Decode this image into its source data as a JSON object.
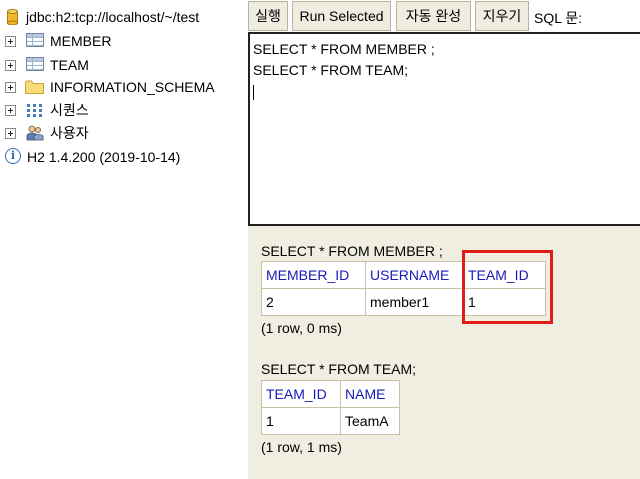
{
  "tree": {
    "connection": "jdbc:h2:tcp://localhost/~/test",
    "items": [
      {
        "label": "MEMBER",
        "icon": "table-icon"
      },
      {
        "label": "TEAM",
        "icon": "table-icon"
      },
      {
        "label": "INFORMATION_SCHEMA",
        "icon": "folder-icon"
      },
      {
        "label": "시퀀스",
        "icon": "sequence-icon"
      },
      {
        "label": "사용자",
        "icon": "users-icon"
      }
    ],
    "version": "H2 1.4.200 (2019-10-14)"
  },
  "toolbar": {
    "run_label": "실행",
    "run_selected_label": "Run Selected",
    "autocomplete_label": "자동 완성",
    "clear_label": "지우기",
    "sql_label": "SQL 문:"
  },
  "editor": {
    "line1": "SELECT * FROM MEMBER ;",
    "line2": "SELECT * FROM TEAM;"
  },
  "results": [
    {
      "query": "SELECT * FROM MEMBER ;",
      "columns": [
        "MEMBER_ID",
        "USERNAME",
        "TEAM_ID"
      ],
      "rows": [
        [
          "2",
          "member1",
          "1"
        ]
      ],
      "meta": "(1 row, 0 ms)"
    },
    {
      "query": "SELECT * FROM TEAM;",
      "columns": [
        "TEAM_ID",
        "NAME"
      ],
      "rows": [
        [
          "1",
          "TeamA"
        ]
      ],
      "meta": "(1 row, 1 ms)"
    }
  ],
  "colors": {
    "panel_bg": "#f0eee0",
    "header_text": "#1a1ab8",
    "highlight": "#e21b1b"
  }
}
